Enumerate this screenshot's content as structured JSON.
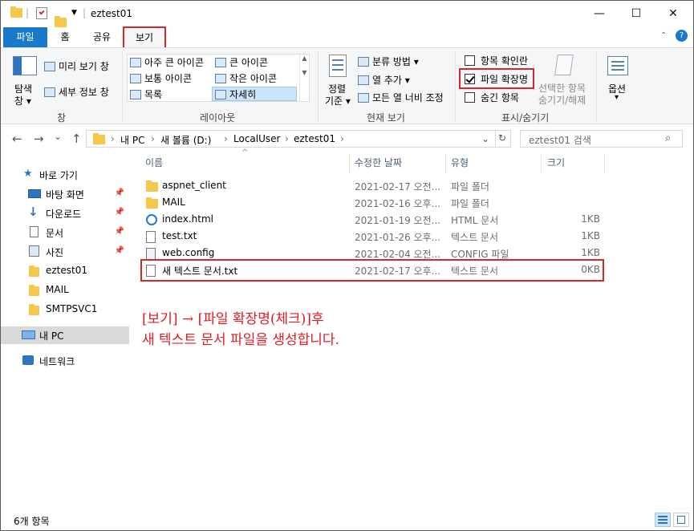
{
  "window": {
    "title": "eztest01",
    "qat_separator": "|",
    "controls": [
      "—",
      "☐",
      "✕"
    ]
  },
  "tabs": {
    "file": "파일",
    "home": "홈",
    "share": "공유",
    "view": "보기"
  },
  "ribbon": {
    "pane": {
      "nav_pane_line1": "탐색",
      "nav_pane_line2": "창 ▾",
      "preview": "미리 보기 창",
      "details": "세부 정보 창",
      "group": "창"
    },
    "layout": {
      "items": [
        "아주 큰 아이콘",
        "큰 아이콘",
        "보통 아이콘",
        "작은 아이콘",
        "목록",
        "자세히"
      ],
      "group": "레이아웃"
    },
    "current_view": {
      "sort_line1": "정렬",
      "sort_line2": "기준 ▾",
      "group_by": "분류 방법 ▾",
      "add_columns": "열 추가 ▾",
      "size_all": "모든 열 너비 조정",
      "group": "현재 보기"
    },
    "show_hide": {
      "item_checkboxes": "항목 확인란",
      "file_extensions": "파일 확장명",
      "hidden_items": "숨긴 항목",
      "hide_selected_line1": "선택한 항목",
      "hide_selected_line2": "숨기기/해제",
      "group": "표시/숨기기"
    },
    "options": {
      "label": "옵션",
      "arrow": "▾"
    }
  },
  "nav": {
    "back": "←",
    "forward": "→",
    "recent": "⌄",
    "up": "↑",
    "breadcrumb": [
      "내 PC",
      "새 볼륨 (D:)",
      "LocalUser",
      "eztest01"
    ],
    "breadcrumb_sep": "›",
    "refresh": "↻",
    "search_placeholder": "eztest01 검색"
  },
  "sidebar": {
    "quick_access": "바로 가기",
    "items": [
      "바탕 화면",
      "다운로드",
      "문서",
      "사진",
      "eztest01",
      "MAIL",
      "SMTPSVC1"
    ],
    "this_pc": "내 PC",
    "network": "네트워크"
  },
  "columns": {
    "name": "이름",
    "date": "수정한 날짜",
    "type": "유형",
    "size": "크기"
  },
  "files": [
    {
      "name": "aspnet_client",
      "date": "2021-02-17 오전...",
      "type": "파일 폴더",
      "size": "",
      "icon": "folder-icon"
    },
    {
      "name": "MAIL",
      "date": "2021-02-16 오후...",
      "type": "파일 폴더",
      "size": "",
      "icon": "folder-icon"
    },
    {
      "name": "index.html",
      "date": "2021-01-19 오전...",
      "type": "HTML 문서",
      "size": "1KB",
      "icon": "ie-icon"
    },
    {
      "name": "test.txt",
      "date": "2021-01-26 오후...",
      "type": "텍스트 문서",
      "size": "1KB",
      "icon": "text-file-icon"
    },
    {
      "name": "web.config",
      "date": "2021-02-04 오전...",
      "type": "CONFIG 파일",
      "size": "1KB",
      "icon": "config-file-icon"
    },
    {
      "name": "새 텍스트 문서.txt",
      "date": "2021-02-17 오후...",
      "type": "텍스트 문서",
      "size": "0KB",
      "icon": "text-file-icon"
    }
  ],
  "annotation": {
    "line1": "[보기] → [파일 확장명(체크)]후",
    "line2": "새 텍스트 문서 파일을 생성합니다."
  },
  "status": {
    "count": "6개 항목"
  },
  "colors": {
    "file_tab": "#1979ca",
    "highlight_red": "#d9262b",
    "annotation_red": "#e01b24"
  }
}
